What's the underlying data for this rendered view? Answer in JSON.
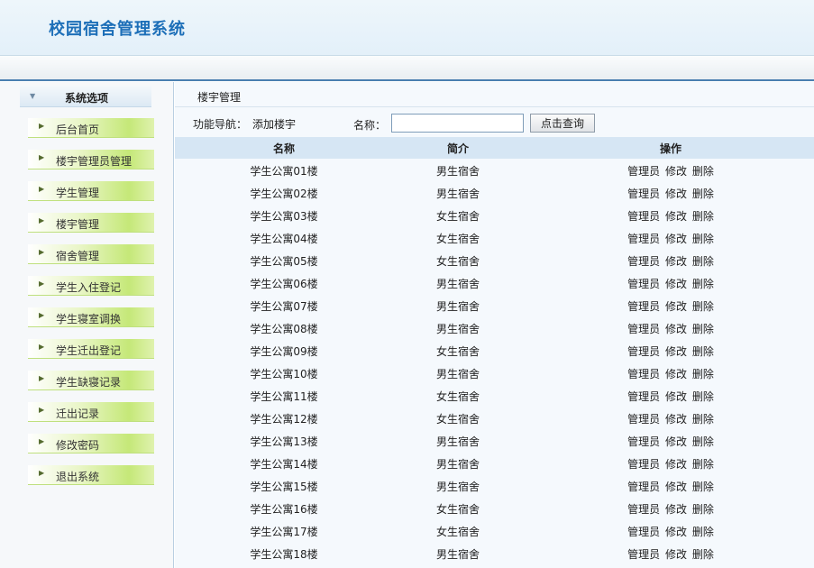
{
  "header": {
    "title": "校园宿舍管理系统"
  },
  "sidebar": {
    "title": "系统选项",
    "items": [
      {
        "label": "后台首页"
      },
      {
        "label": "楼宇管理员管理"
      },
      {
        "label": "学生管理"
      },
      {
        "label": "楼宇管理"
      },
      {
        "label": "宿舍管理"
      },
      {
        "label": "学生入住登记"
      },
      {
        "label": "学生寝室调换"
      },
      {
        "label": "学生迁出登记"
      },
      {
        "label": "学生缺寝记录"
      },
      {
        "label": "迁出记录"
      },
      {
        "label": "修改密码"
      },
      {
        "label": "退出系统"
      }
    ]
  },
  "main": {
    "breadcrumb": "楼宇管理",
    "func_nav_label": "功能导航：",
    "add_link": "添加楼宇",
    "search_label": "名称：",
    "search_value": "",
    "search_button": "点击查询",
    "columns": [
      "名称",
      "简介",
      "操作"
    ],
    "actions": [
      "管理员",
      "修改",
      "删除"
    ],
    "rows": [
      {
        "name": "学生公寓01楼",
        "desc": "男生宿舍"
      },
      {
        "name": "学生公寓02楼",
        "desc": "男生宿舍"
      },
      {
        "name": "学生公寓03楼",
        "desc": "女生宿舍"
      },
      {
        "name": "学生公寓04楼",
        "desc": "女生宿舍"
      },
      {
        "name": "学生公寓05楼",
        "desc": "女生宿舍"
      },
      {
        "name": "学生公寓06楼",
        "desc": "男生宿舍"
      },
      {
        "name": "学生公寓07楼",
        "desc": "男生宿舍"
      },
      {
        "name": "学生公寓08楼",
        "desc": "男生宿舍"
      },
      {
        "name": "学生公寓09楼",
        "desc": "女生宿舍"
      },
      {
        "name": "学生公寓10楼",
        "desc": "男生宿舍"
      },
      {
        "name": "学生公寓11楼",
        "desc": "女生宿舍"
      },
      {
        "name": "学生公寓12楼",
        "desc": "女生宿舍"
      },
      {
        "name": "学生公寓13楼",
        "desc": "男生宿舍"
      },
      {
        "name": "学生公寓14楼",
        "desc": "男生宿舍"
      },
      {
        "name": "学生公寓15楼",
        "desc": "男生宿舍"
      },
      {
        "name": "学生公寓16楼",
        "desc": "女生宿舍"
      },
      {
        "name": "学生公寓17楼",
        "desc": "女生宿舍"
      },
      {
        "name": "学生公寓18楼",
        "desc": "男生宿舍"
      }
    ]
  }
}
